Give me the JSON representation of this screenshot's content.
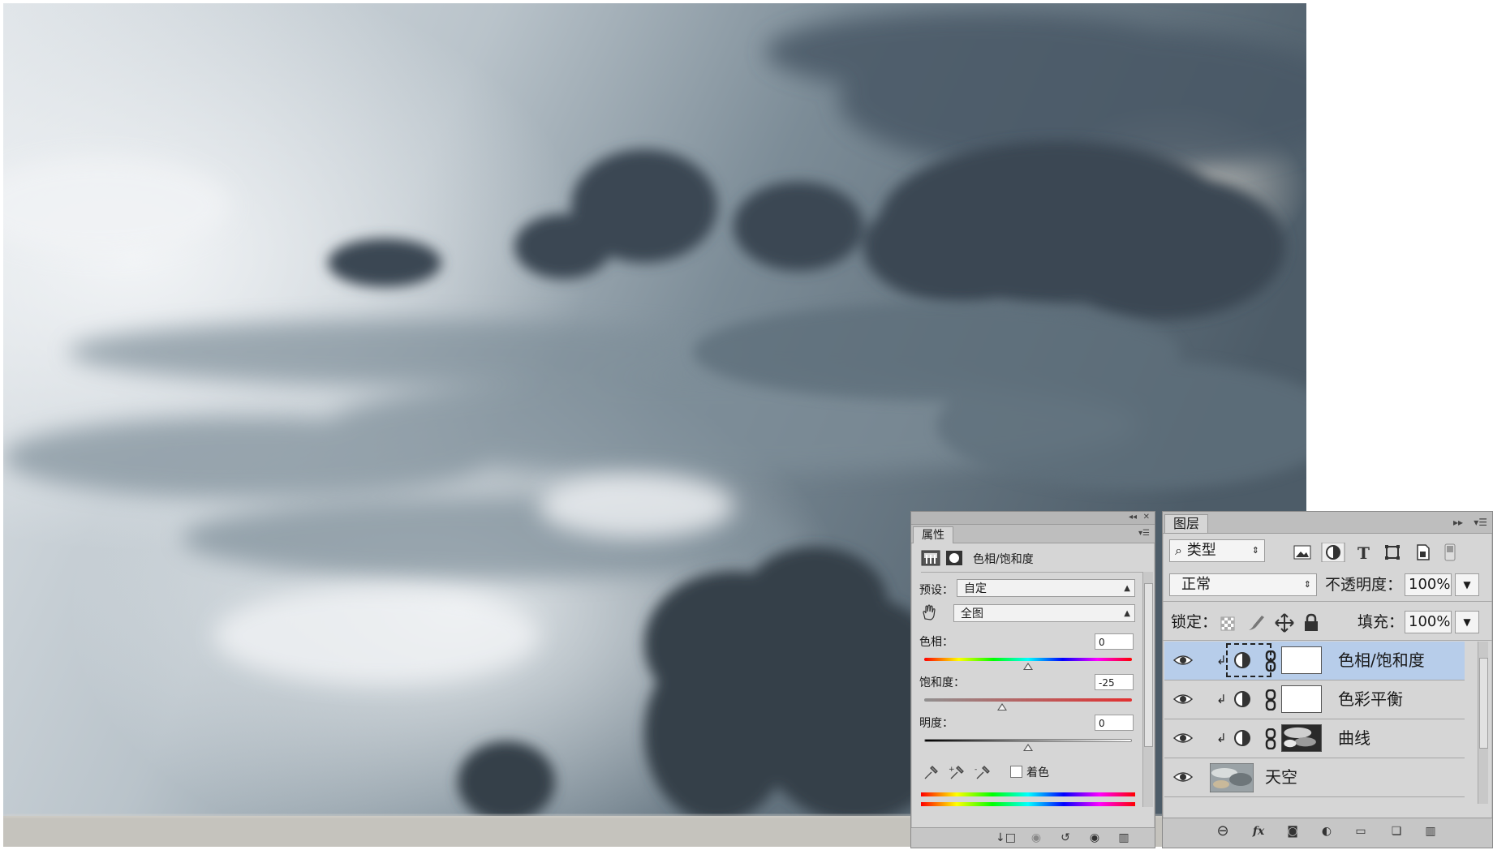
{
  "properties_panel": {
    "tab_label": "属性",
    "adjustment_title": "色相/饱和度",
    "preset_label": "预设：",
    "preset_value": "自定",
    "channel_value": "全图",
    "hue_label": "色相：",
    "hue_value": "0",
    "saturation_label": "饱和度：",
    "saturation_value": "-25",
    "lightness_label": "明度：",
    "lightness_value": "0",
    "colorize_label": "着色",
    "hue_level": 0.5,
    "saturation_level": 0.375,
    "lightness_level": 0.5
  },
  "layers_panel": {
    "tab_label": "图层",
    "filter_kind": "类型",
    "blend_mode": "正常",
    "opacity_label": "不透明度：",
    "opacity_value": "100%",
    "lock_label": "锁定：",
    "fill_label": "填充：",
    "fill_value": "100%",
    "layers": [
      {
        "name": "色相/饱和度",
        "selected": true
      },
      {
        "name": "色彩平衡",
        "selected": false
      },
      {
        "name": "曲线",
        "selected": false
      },
      {
        "name": "天空",
        "selected": false
      }
    ]
  },
  "colors": {
    "selection": "#b7cdea",
    "panel_bg": "#d6d6d6"
  },
  "icons": {
    "filter": "search-icon",
    "pixel_filter": "image-icon",
    "adjustment_filter": "half-circle-icon",
    "type_filter": "text-icon",
    "shape_filter": "shape-icon",
    "smart_filter": "smart-object-icon",
    "visibility": "eye-icon",
    "link": "link-icon",
    "fx": "fx-icon",
    "new_group": "folder-icon",
    "delete": "trash-icon"
  }
}
